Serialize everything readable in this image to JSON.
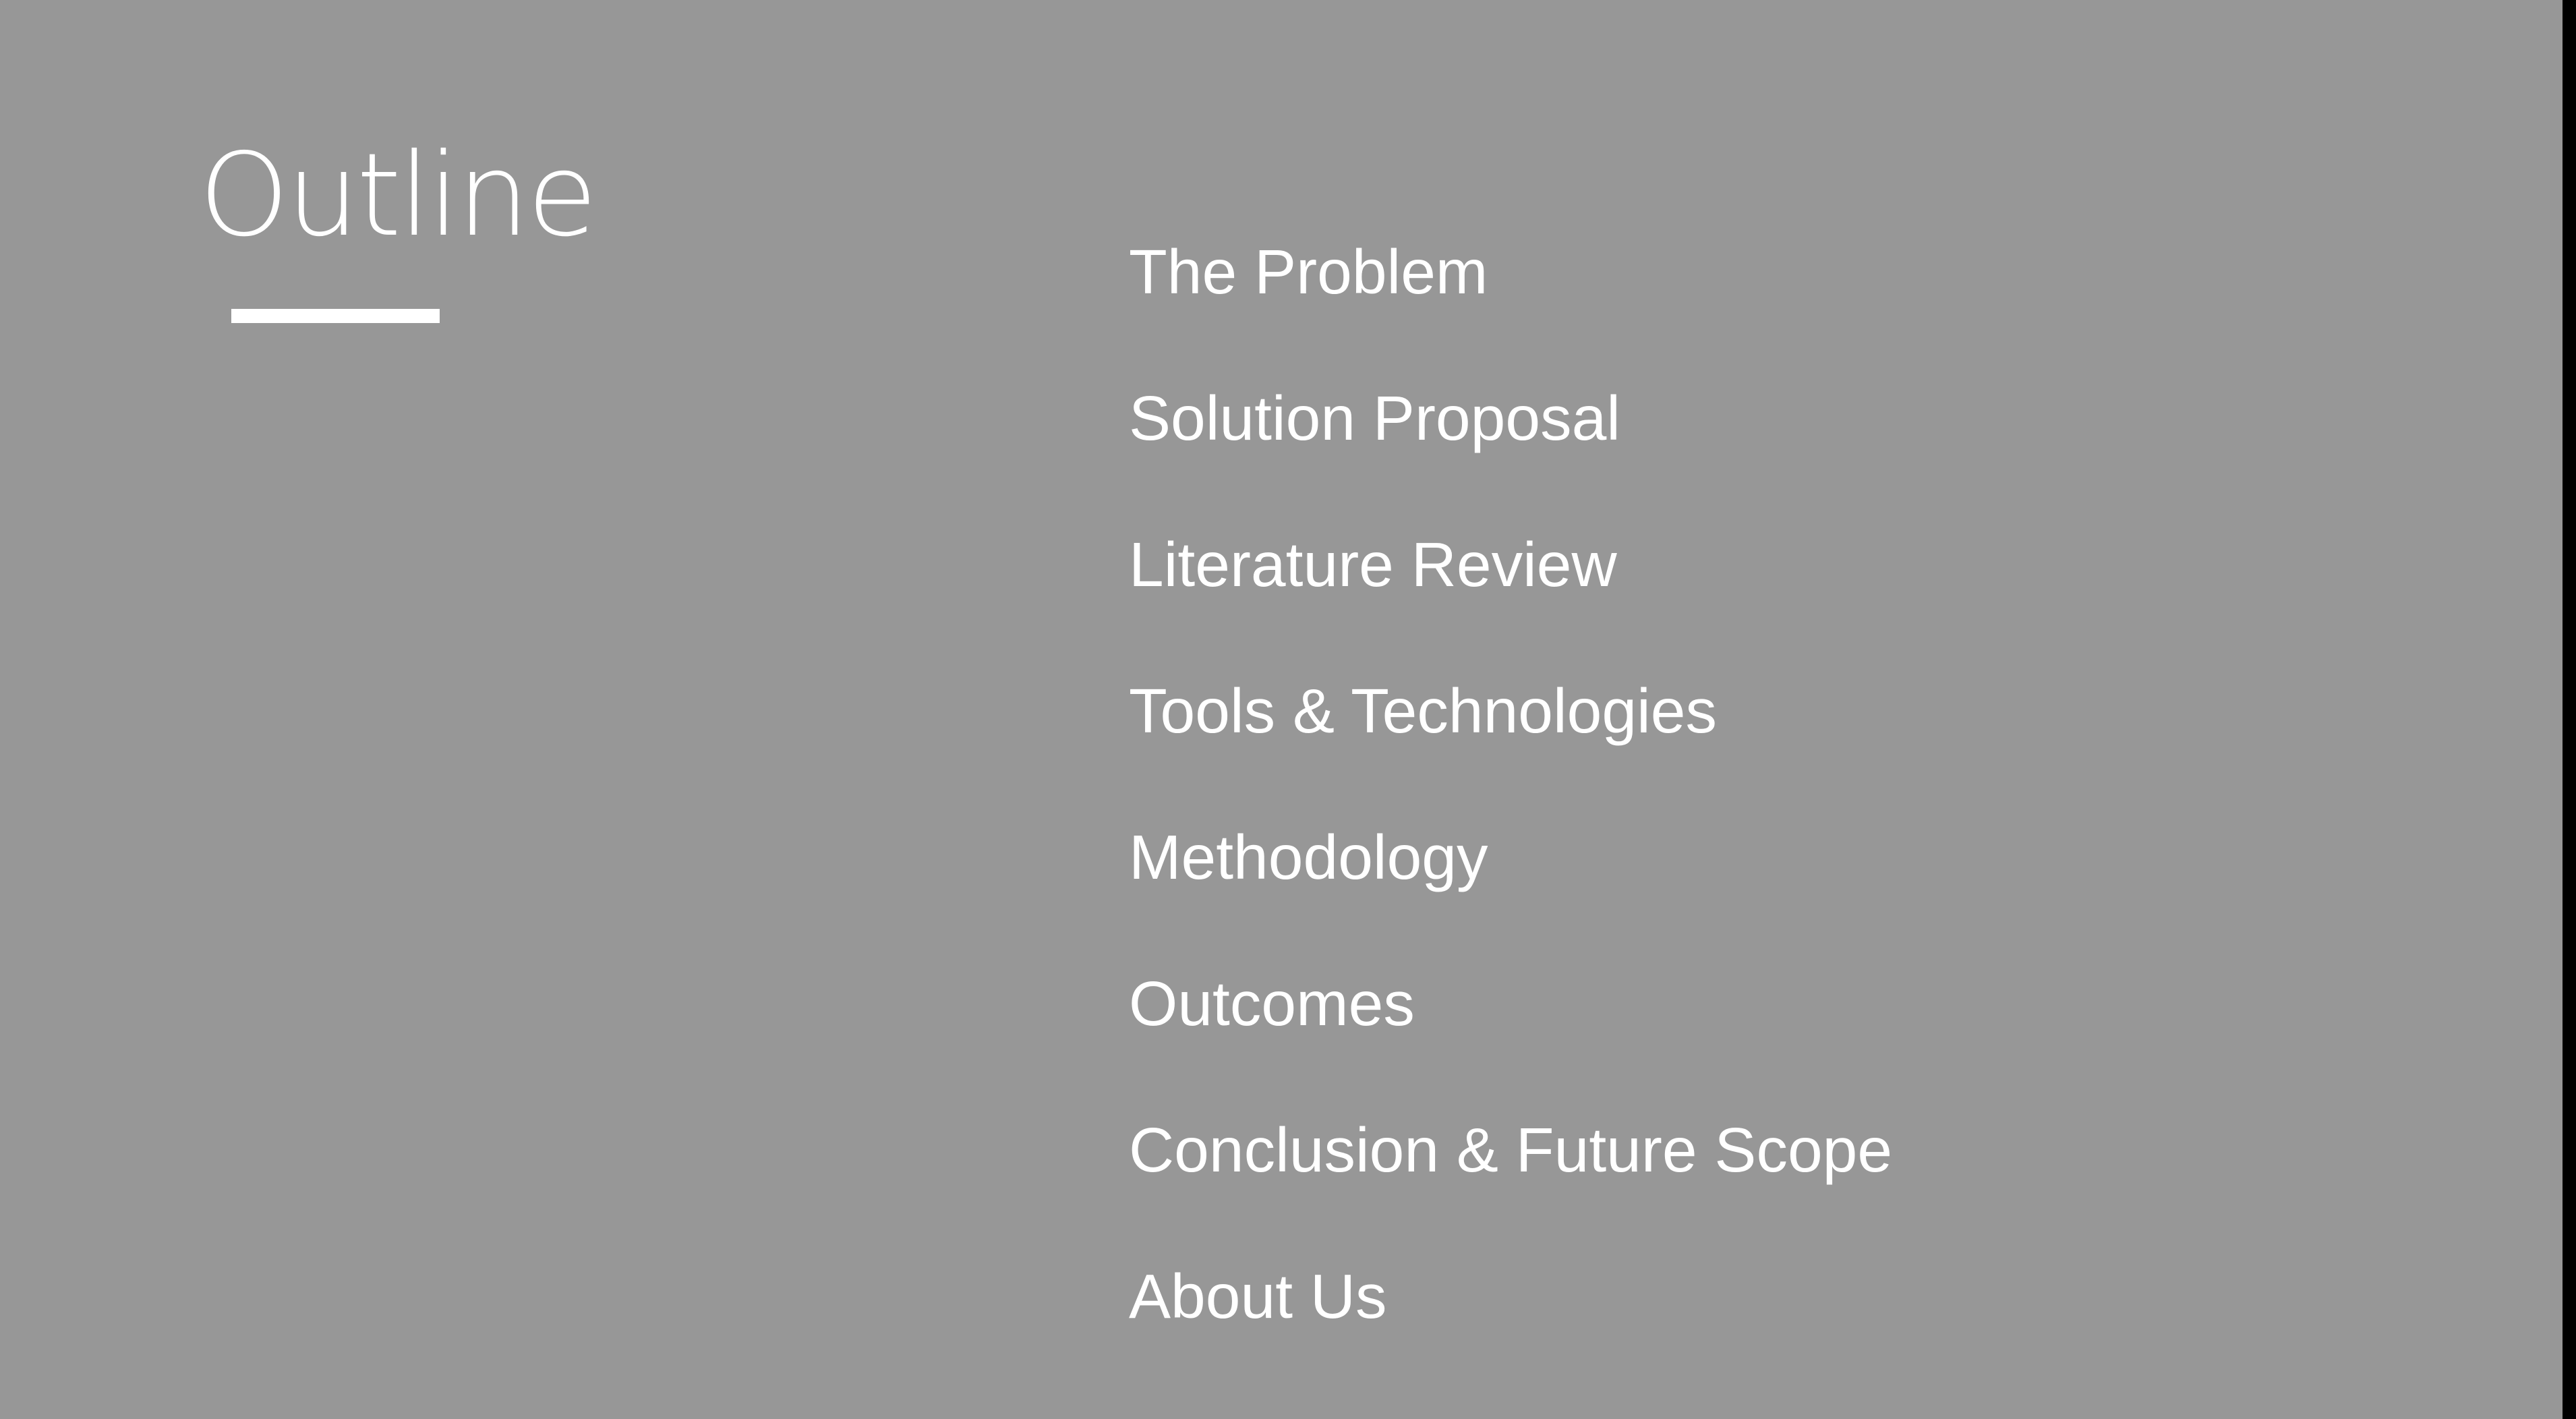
{
  "slide": {
    "title": "Outline",
    "background_color": "#979797",
    "text_color": "#ffffff"
  },
  "outline": {
    "items": [
      {
        "label": "The Problem"
      },
      {
        "label": "Solution Proposal"
      },
      {
        "label": "Literature Review"
      },
      {
        "label": "Tools & Technologies"
      },
      {
        "label": "Methodology"
      },
      {
        "label": "Outcomes"
      },
      {
        "label": "Conclusion & Future Scope"
      },
      {
        "label": "About Us"
      }
    ]
  }
}
